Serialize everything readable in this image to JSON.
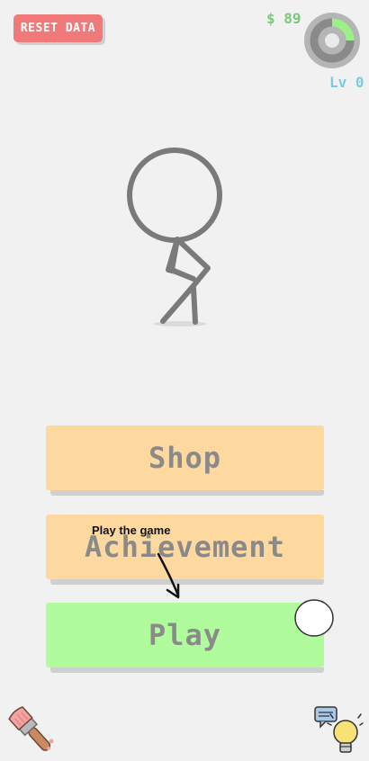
{
  "header": {
    "reset_label": "RESET DATA",
    "money": "$ 89",
    "level": "Lv 0",
    "level_progress": 0.25
  },
  "menu": {
    "shop_label": "Shop",
    "achievement_label": "Achievement",
    "play_label": "Play"
  },
  "tutorial": {
    "hint": "Play the game"
  },
  "icons": {
    "brush": "paintbrush-icon",
    "hint": "lightbulb-icon"
  },
  "colors": {
    "reset": "#f07a7a",
    "money": "#7ac97a",
    "level": "#7ec8e3",
    "shop": "#fdd9a0",
    "play": "#b0fc9c"
  }
}
